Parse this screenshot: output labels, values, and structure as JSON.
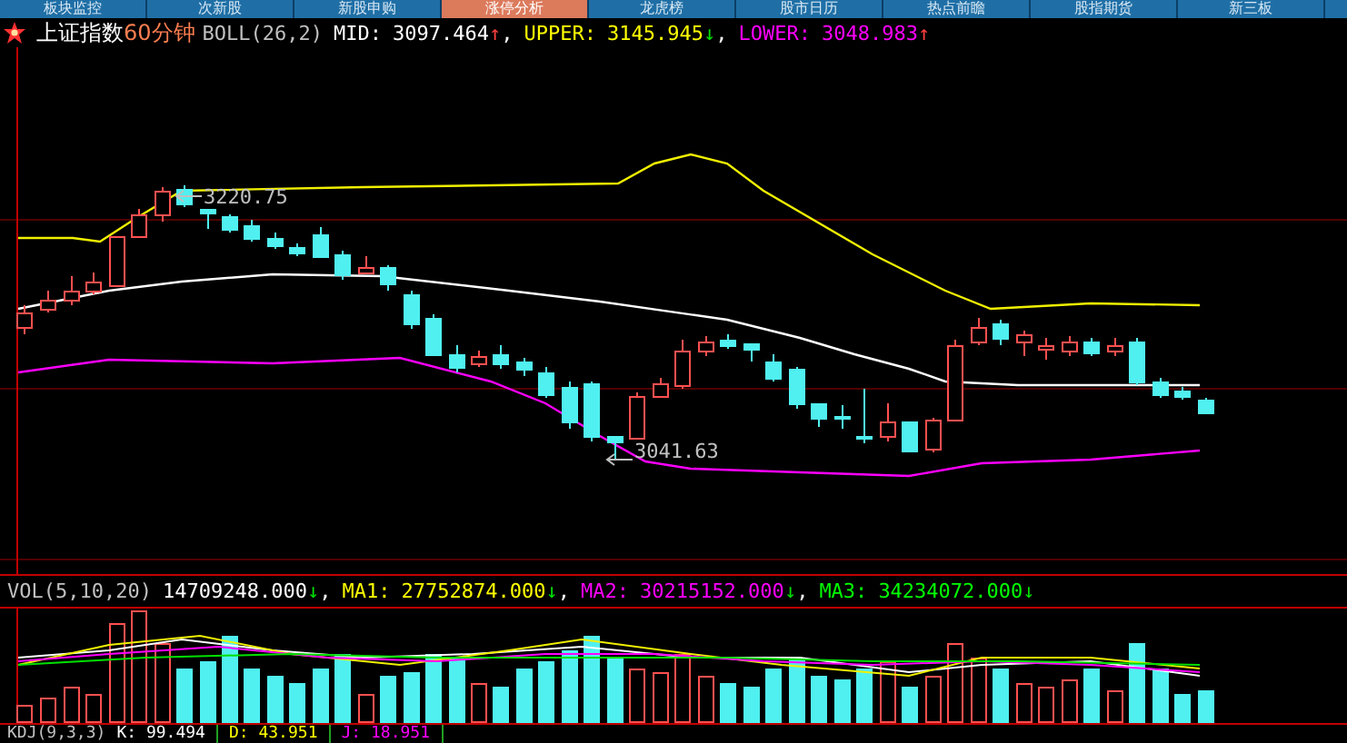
{
  "tabs": [
    {
      "label": "板块监控",
      "selected": false
    },
    {
      "label": "次新股",
      "selected": false
    },
    {
      "label": "新股申购",
      "selected": false
    },
    {
      "label": "涨停分析",
      "selected": true
    },
    {
      "label": "龙虎榜",
      "selected": false
    },
    {
      "label": "股市日历",
      "selected": false
    },
    {
      "label": "热点前瞻",
      "selected": false
    },
    {
      "label": "股指期货",
      "selected": false
    },
    {
      "label": "新三板",
      "selected": false
    }
  ],
  "header": {
    "index_name": "上证指数",
    "period": "60分钟",
    "indicator": "BOLL(26,2)",
    "values": [
      {
        "label": "MID:",
        "value": "3097.464",
        "arrow": {
          "text": "↑",
          "color": "#ff4040"
        },
        "suffix": ",",
        "color": "#ffffff"
      },
      {
        "label": "UPPER:",
        "value": "3145.945",
        "arrow": {
          "text": "↓",
          "color": "#00e000"
        },
        "suffix": ",",
        "color": "#ffff00"
      },
      {
        "label": "LOWER:",
        "value": "3048.983",
        "arrow": {
          "text": "↑",
          "color": "#ff4040"
        },
        "color": "#ff00ff"
      }
    ]
  },
  "price_chart": {
    "annotations": [
      {
        "kind": "high",
        "text": "3220.75"
      },
      {
        "kind": "low",
        "text": "3041.63"
      }
    ]
  },
  "volume": {
    "indicator": "VOL(5,10,20)",
    "values": [
      {
        "value": "14709248.000",
        "arrow": {
          "text": "↓",
          "color": "#00e000"
        },
        "suffix": ",",
        "color": "#ffffff"
      },
      {
        "label": "MA1:",
        "value": "27752874.000",
        "arrow": {
          "text": "↓",
          "color": "#00e000"
        },
        "suffix": ",",
        "color": "#ffff00"
      },
      {
        "label": "MA2:",
        "value": "30215152.000",
        "arrow": {
          "text": "↓",
          "color": "#00e000"
        },
        "suffix": ",",
        "color": "#ff00ff"
      },
      {
        "label": "MA3:",
        "value": "34234072.000",
        "arrow": {
          "text": "↓",
          "color": "#00e000"
        },
        "color": "#00ff00"
      }
    ]
  },
  "kdj": {
    "indicator": "KDJ(9,3,3)",
    "values": [
      {
        "label": "K:",
        "value": "99.494",
        "color": "#ffffff"
      },
      {
        "label": "D:",
        "value": "43.951",
        "color": "#ffff00"
      },
      {
        "label": "J:",
        "value": "18.951",
        "color": "#ff00ff"
      }
    ]
  }
}
